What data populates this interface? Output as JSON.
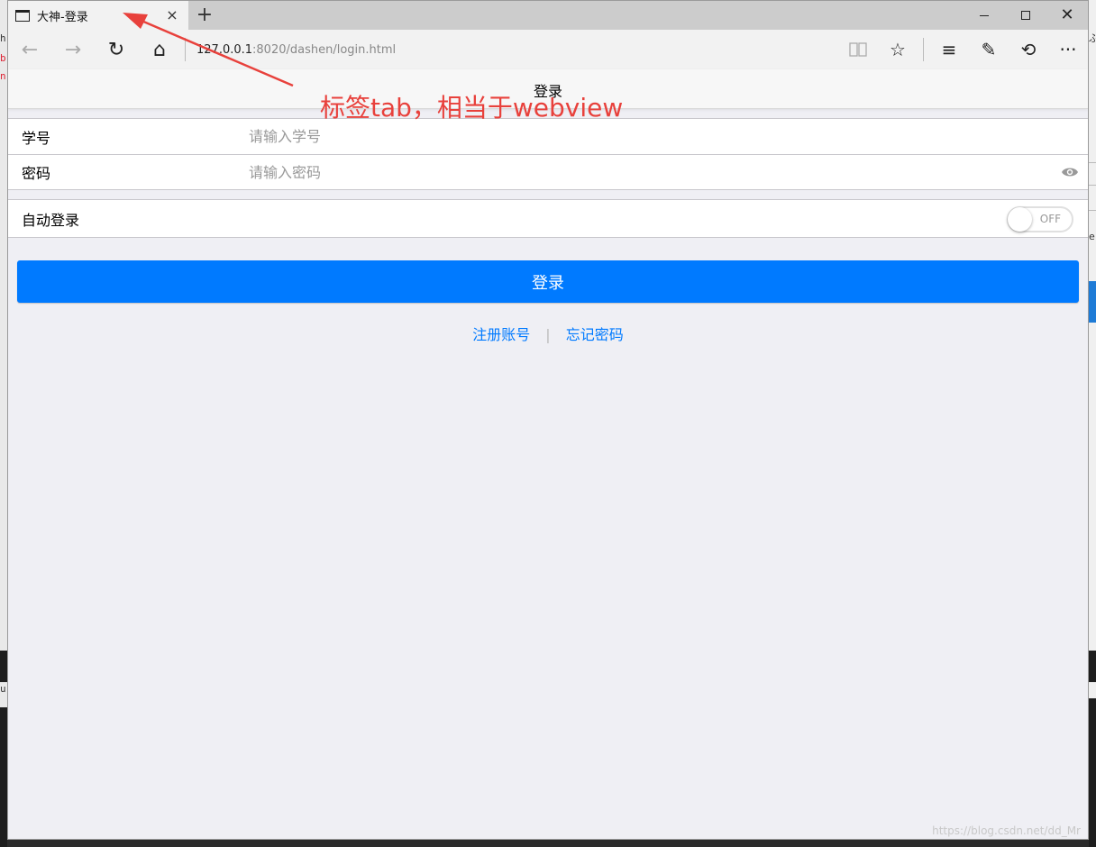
{
  "tab": {
    "title": "大神-登录",
    "close_glyph": "×",
    "new_tab_glyph": "+"
  },
  "window_controls": {
    "close_glyph": "✕"
  },
  "toolbar": {
    "back_glyph": "←",
    "forward_glyph": "→",
    "refresh_glyph": "↻",
    "home_glyph": "⌂",
    "address_host": "127.0.0.1",
    "address_rest": ":8020/dashen/login.html",
    "reading_glyph": "📖",
    "favorite_glyph": "☆",
    "hub_glyph": "≡",
    "note_glyph": "✎",
    "share_glyph": "⟲",
    "more_glyph": "···"
  },
  "navbar": {
    "title": "登录"
  },
  "form": {
    "account_label": "学号",
    "account_placeholder": "请输入学号",
    "account_value": "",
    "password_label": "密码",
    "password_placeholder": "请输入密码",
    "password_value": "",
    "auto_login_label": "自动登录",
    "auto_login_state": "OFF",
    "login_button": "登录"
  },
  "links": {
    "register": "注册账号",
    "separator": "|",
    "forgot": "忘记密码"
  },
  "annotation": {
    "text": "标签tab，相当于webview",
    "color": "#e8413c"
  },
  "watermark": "https://blog.csdn.net/dd_Mr",
  "colors": {
    "primary": "#007aff",
    "page_bg": "#efeff4"
  },
  "background_fragments": {
    "left_1": "h",
    "left_2": "b",
    "left_3": "n",
    "left_4": "u",
    "right_1": "ぷ",
    "right_2": "e"
  }
}
